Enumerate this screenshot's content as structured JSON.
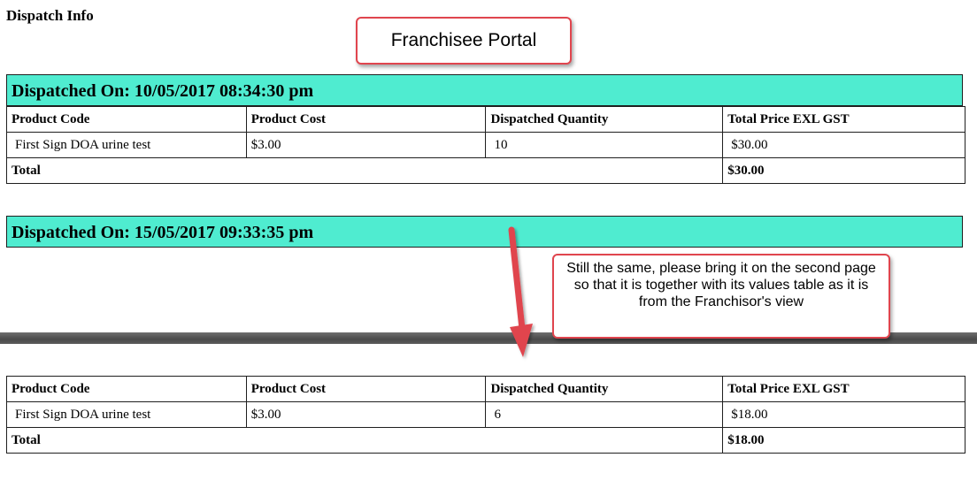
{
  "page": {
    "heading": "Dispatch Info"
  },
  "callouts": {
    "portal": "Franchisee Portal",
    "note": "Still the same, please bring it on the second page so that it is together with its values table as it is from the Franchisor's view",
    "color": "#e0454e"
  },
  "colors": {
    "header_bg": "#4fecd0"
  },
  "columns": [
    "Product Code",
    "Product Cost",
    "Dispatched Quantity",
    "Total Price EXL GST"
  ],
  "dispatches": [
    {
      "header": "Dispatched On: 10/05/2017 08:34:30 pm",
      "row": {
        "product": "First Sign DOA urine test",
        "cost": "$3.00",
        "qty": "10",
        "total": " $30.00"
      },
      "total_label": "Total",
      "total_value": "$30.00"
    },
    {
      "header": "Dispatched On: 15/05/2017 09:33:35 pm",
      "row": {
        "product": "First Sign DOA urine test",
        "cost": "$3.00",
        "qty": "6",
        "total": " $18.00"
      },
      "total_label": "Total",
      "total_value": "$18.00"
    }
  ]
}
